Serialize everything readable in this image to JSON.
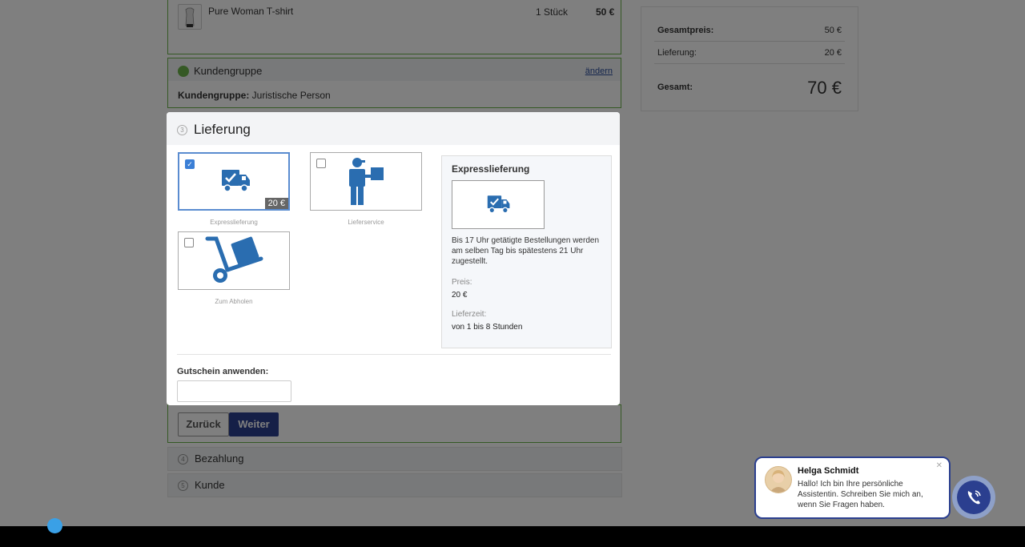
{
  "product": {
    "name": "Pure Woman T-shirt",
    "quantity": "1 Stück",
    "price": "50 €"
  },
  "customer_group": {
    "title": "Kundengruppe",
    "change_link": "ändern",
    "label": "Kundengruppe:",
    "value": "Juristische Person"
  },
  "summary": {
    "total_label": "Gesamtpreis:",
    "total_value": "50 €",
    "delivery_label": "Lieferung:",
    "delivery_value": "20 €",
    "grand_label": "Gesamt:",
    "grand_value": "70 €"
  },
  "delivery_step": {
    "number": "3",
    "title": "Lieferung",
    "options": [
      {
        "name": "Expresslieferung",
        "price": "20 €",
        "selected": true,
        "icon": "truck-check-icon"
      },
      {
        "name": "Lieferservice",
        "price": "",
        "selected": false,
        "icon": "courier-person-icon"
      },
      {
        "name": "Zum Abholen",
        "price": "",
        "selected": false,
        "icon": "hand-trolley-icon"
      }
    ],
    "detail": {
      "title": "Expresslieferung",
      "description": "Bis 17 Uhr getätigte Bestellungen werden am selben Tag bis spätestens 21 Uhr zugestellt.",
      "price_label": "Preis:",
      "price_value": "20 €",
      "time_label": "Lieferzeit:",
      "time_value": "von 1 bis 8 Stunden"
    },
    "coupon_label": "Gutschein anwenden:",
    "coupon_value": ""
  },
  "nav": {
    "back_label": "Zurück",
    "next_label": "Weiter"
  },
  "steps": [
    {
      "number": "4",
      "label": "Bezahlung"
    },
    {
      "number": "5",
      "label": "Kunde"
    }
  ],
  "chat": {
    "name": "Helga Schmidt",
    "message": "Hallo! Ich bin Ihre persönliche Assistentin. Schreiben Sie mich an, wenn Sie Fragen haben."
  },
  "colors": {
    "accent": "#2b3f8f",
    "green": "#6bb34a",
    "icon_blue": "#2a6db0"
  }
}
